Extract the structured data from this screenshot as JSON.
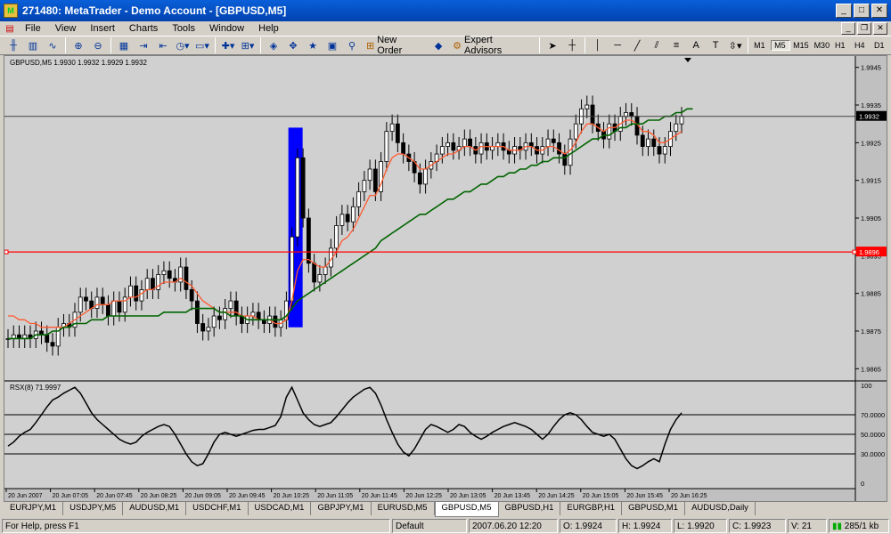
{
  "window": {
    "title": "271480: MetaTrader - Demo Account - [GBPUSD,M5]"
  },
  "menu": [
    "File",
    "View",
    "Insert",
    "Charts",
    "Tools",
    "Window",
    "Help"
  ],
  "toolbar": {
    "new_order": "New Order",
    "expert_advisors": "Expert Advisors",
    "text_tool": "A",
    "timeframes": [
      "M1",
      "M5",
      "M15",
      "M30",
      "H1",
      "H4",
      "D1"
    ],
    "active_timeframe": "M5"
  },
  "chart": {
    "info": "GBPUSD,M5  1.9930 1.9932 1.9929 1.9932",
    "price_ticks": [
      "1.9945",
      "1.9935",
      "1.9925",
      "1.9915",
      "1.9905",
      "1.9895",
      "1.9885",
      "1.9875",
      "1.9865"
    ],
    "current_price": "1.9932",
    "line_price": "1.9896",
    "indicator_label": "RSX(8) 71.9997",
    "indicator_ticks": [
      "100",
      "70.0000",
      "50.0000",
      "30.0000",
      "0"
    ],
    "time_labels": [
      "20 Jun 2007",
      "20 Jun 07:05",
      "20 Jun 07:45",
      "20 Jun 08:25",
      "20 Jun 09:05",
      "20 Jun 09:45",
      "20 Jun 10:25",
      "20 Jun 11:05",
      "20 Jun 11:45",
      "20 Jun 12:25",
      "20 Jun 13:05",
      "20 Jun 13:45",
      "20 Jun 14:25",
      "20 Jun 15:05",
      "20 Jun 15:45",
      "20 Jun 16:25"
    ]
  },
  "chart_data": {
    "type": "line",
    "title": "GBPUSD,M5",
    "price_ylim": [
      1.9862,
      1.9948
    ],
    "closes": [
      1.9873,
      1.9874,
      1.9873,
      1.9874,
      1.9873,
      1.9875,
      1.9874,
      1.9872,
      1.9871,
      1.9876,
      1.9877,
      1.9876,
      1.988,
      1.9884,
      1.9883,
      1.9881,
      1.9884,
      1.9882,
      1.9879,
      1.9883,
      1.988,
      1.9884,
      1.9887,
      1.9883,
      1.9886,
      1.9889,
      1.9886,
      1.989,
      1.9891,
      1.9889,
      1.9888,
      1.9892,
      1.9886,
      1.9883,
      1.9877,
      1.9875,
      1.9876,
      1.9879,
      1.9878,
      1.9881,
      1.9883,
      1.9879,
      1.9877,
      1.9879,
      1.988,
      1.9878,
      1.9877,
      1.9879,
      1.9876,
      1.9878,
      1.9883,
      1.99,
      1.9921,
      1.9905,
      1.9893,
      1.9888,
      1.989,
      1.9892,
      1.9897,
      1.9903,
      1.9906,
      1.9904,
      1.9908,
      1.9912,
      1.9915,
      1.9918,
      1.9912,
      1.992,
      1.9928,
      1.993,
      1.9925,
      1.9922,
      1.992,
      1.9917,
      1.9914,
      1.9918,
      1.992,
      1.9922,
      1.9924,
      1.9925,
      1.9923,
      1.9924,
      1.9926,
      1.9924,
      1.9922,
      1.9925,
      1.9923,
      1.9924,
      1.9925,
      1.9923,
      1.9922,
      1.9924,
      1.9923,
      1.9925,
      1.9924,
      1.9922,
      1.9924,
      1.9926,
      1.9925,
      1.9922,
      1.9919,
      1.9926,
      1.993,
      1.9934,
      1.9935,
      1.993,
      1.9928,
      1.9926,
      1.993,
      1.9928,
      1.9932,
      1.9933,
      1.9932,
      1.9927,
      1.9924,
      1.9926,
      1.9924,
      1.9922,
      1.9924,
      1.9928,
      1.993,
      1.9932
    ],
    "ma_fast": [
      1.9879,
      1.9879,
      1.9878,
      1.9878,
      1.9877,
      1.9877,
      1.9876,
      1.9876,
      1.9876,
      1.9876,
      1.9876,
      1.9877,
      1.9878,
      1.9879,
      1.988,
      1.9881,
      1.9882,
      1.9882,
      1.9882,
      1.9883,
      1.9883,
      1.9883,
      1.9884,
      1.9884,
      1.9885,
      1.9886,
      1.9886,
      1.9887,
      1.9888,
      1.9888,
      1.9888,
      1.9889,
      1.9888,
      1.9887,
      1.9885,
      1.9883,
      1.9882,
      1.9881,
      1.988,
      1.988,
      1.988,
      1.988,
      1.9879,
      1.9879,
      1.9879,
      1.9878,
      1.9878,
      1.9878,
      1.9877,
      1.9877,
      1.9878,
      1.9883,
      1.9891,
      1.9894,
      1.9894,
      1.9893,
      1.9892,
      1.9892,
      1.9894,
      1.9896,
      1.9899,
      1.99,
      1.9902,
      1.9905,
      1.9908,
      1.9911,
      1.9911,
      1.9914,
      1.9918,
      1.9921,
      1.9922,
      1.9922,
      1.9921,
      1.992,
      1.9918,
      1.9918,
      1.9919,
      1.992,
      1.9921,
      1.9922,
      1.9922,
      1.9923,
      1.9924,
      1.9924,
      1.9923,
      1.9924,
      1.9924,
      1.9924,
      1.9924,
      1.9924,
      1.9923,
      1.9923,
      1.9923,
      1.9924,
      1.9924,
      1.9923,
      1.9923,
      1.9924,
      1.9924,
      1.9923,
      1.9922,
      1.9923,
      1.9925,
      1.9928,
      1.993,
      1.993,
      1.9929,
      1.9928,
      1.9929,
      1.9929,
      1.993,
      1.9931,
      1.9931,
      1.993,
      1.9928,
      1.9928,
      1.9927,
      1.9925,
      1.9925,
      1.9926,
      1.9927,
      1.9928
    ],
    "ma_slow": [
      1.9873,
      1.9873,
      1.9873,
      1.9873,
      1.9873,
      1.9874,
      1.9874,
      1.9874,
      1.9875,
      1.9875,
      1.9876,
      1.9876,
      1.9877,
      1.9877,
      1.9877,
      1.9878,
      1.9878,
      1.9878,
      1.9879,
      1.9879,
      1.9879,
      1.9879,
      1.9879,
      1.9879,
      1.9879,
      1.9879,
      1.9879,
      1.9879,
      1.988,
      1.988,
      1.988,
      1.988,
      1.988,
      1.9881,
      1.9881,
      1.9881,
      1.9881,
      1.9881,
      1.988,
      1.988,
      1.9879,
      1.9879,
      1.9879,
      1.9878,
      1.9878,
      1.9878,
      1.9878,
      1.9878,
      1.9878,
      1.9878,
      1.9879,
      1.9881,
      1.9883,
      1.9884,
      1.9885,
      1.9886,
      1.9887,
      1.9888,
      1.9889,
      1.989,
      1.9891,
      1.9892,
      1.9893,
      1.9894,
      1.9895,
      1.9896,
      1.9897,
      1.9899,
      1.99,
      1.9901,
      1.9902,
      1.9903,
      1.9904,
      1.9905,
      1.9906,
      1.9906,
      1.9907,
      1.9908,
      1.9909,
      1.991,
      1.991,
      1.9911,
      1.9912,
      1.9912,
      1.9913,
      1.9914,
      1.9914,
      1.9915,
      1.9916,
      1.9916,
      1.9917,
      1.9917,
      1.9918,
      1.9918,
      1.9919,
      1.9919,
      1.992,
      1.992,
      1.9921,
      1.9921,
      1.9921,
      1.9922,
      1.9923,
      1.9924,
      1.9925,
      1.9926,
      1.9926,
      1.9927,
      1.9927,
      1.9928,
      1.9929,
      1.9929,
      1.993,
      1.993,
      1.993,
      1.9931,
      1.9931,
      1.9931,
      1.9932,
      1.9932,
      1.9933,
      1.9933,
      1.9934,
      1.9934
    ],
    "rsx": [
      38,
      42,
      48,
      52,
      55,
      62,
      70,
      78,
      85,
      88,
      92,
      95,
      98,
      92,
      82,
      72,
      65,
      60,
      55,
      50,
      45,
      42,
      40,
      42,
      48,
      52,
      55,
      58,
      60,
      58,
      50,
      40,
      30,
      22,
      18,
      20,
      30,
      42,
      50,
      52,
      50,
      48,
      50,
      52,
      54,
      55,
      55,
      57,
      59,
      68,
      88,
      98,
      85,
      72,
      65,
      60,
      58,
      60,
      62,
      68,
      75,
      82,
      88,
      92,
      96,
      98,
      92,
      80,
      65,
      52,
      40,
      32,
      28,
      35,
      45,
      55,
      60,
      58,
      55,
      52,
      55,
      60,
      58,
      52,
      48,
      45,
      48,
      52,
      55,
      58,
      60,
      62,
      60,
      58,
      55,
      50,
      45,
      50,
      58,
      65,
      70,
      72,
      70,
      65,
      58,
      52,
      50,
      48,
      50,
      45,
      35,
      25,
      18,
      15,
      18,
      22,
      25,
      22,
      40,
      55,
      65,
      72
    ],
    "sellzone_ylim": [
      1.9876,
      1.9929
    ]
  }
}
